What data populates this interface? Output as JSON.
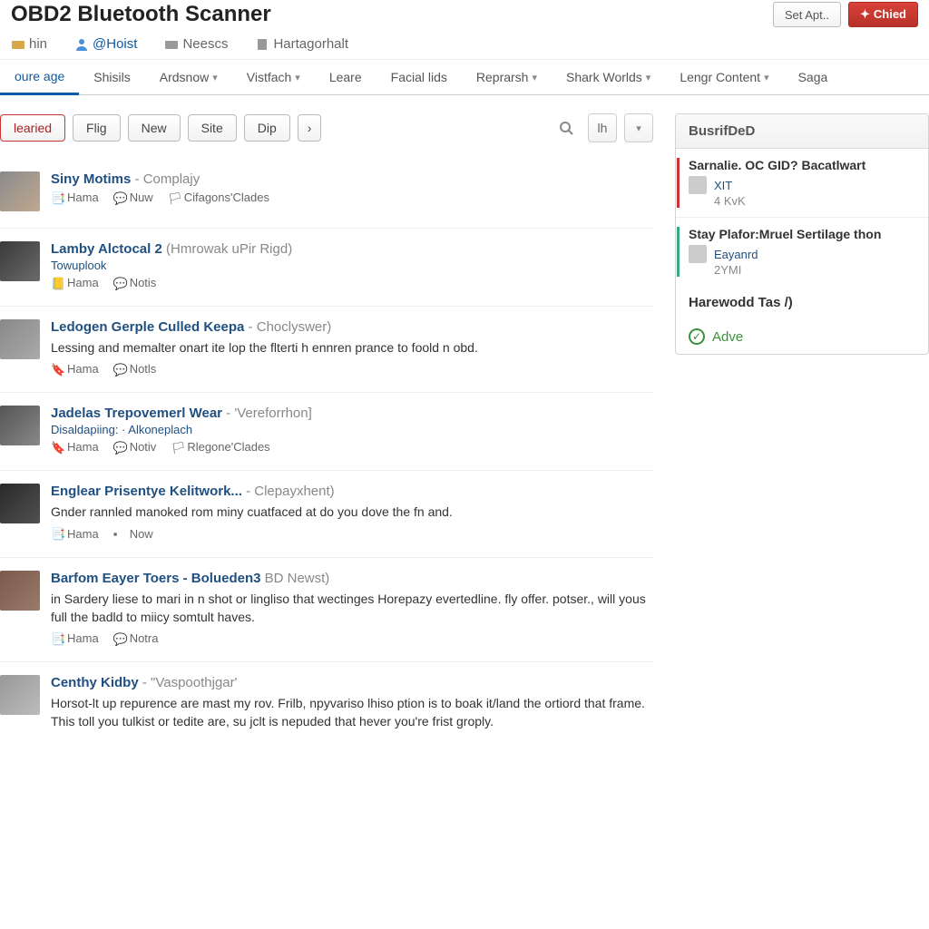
{
  "header": {
    "title": "OBD2 Bluetooth Scanner",
    "actions": {
      "set": "Set Apt..",
      "check": "Chied"
    }
  },
  "topnav": [
    {
      "label": "hin"
    },
    {
      "label": "@Hoist"
    },
    {
      "label": "Neescs"
    },
    {
      "label": "Hartagorhalt"
    }
  ],
  "tabs": [
    {
      "label": "oure age",
      "dd": false
    },
    {
      "label": "Shisils",
      "dd": false
    },
    {
      "label": "Ardsnow",
      "dd": true
    },
    {
      "label": "Vistfach",
      "dd": true
    },
    {
      "label": "Leare",
      "dd": false
    },
    {
      "label": "Facial lids",
      "dd": false
    },
    {
      "label": "Reprarsh",
      "dd": true
    },
    {
      "label": "Shark Worlds",
      "dd": true
    },
    {
      "label": "Lengr Content",
      "dd": true
    },
    {
      "label": "Saga",
      "dd": false
    }
  ],
  "filters": [
    "learied",
    "Flig",
    "New",
    "Site",
    "Dip"
  ],
  "sortLabel": "lh",
  "posts": [
    {
      "title": "Siny Motims",
      "cat": "Complajy",
      "meta": [
        {
          "t": "Hama"
        },
        {
          "t": "Nuw"
        },
        {
          "t": "Cifagons'Clades"
        }
      ]
    },
    {
      "title": "Lamby Alctocal 2",
      "cat": "(Hmrowak uPir Rigd)",
      "sub": "Towuplook",
      "meta": [
        {
          "t": "Hama"
        },
        {
          "t": "Notis"
        }
      ]
    },
    {
      "title": "Ledogen Gerple Culled Keepa",
      "cat": "Choclyswer)",
      "desc": "Lessing and memalter onart ite lop the flterti h ennren prance to foold n obd.",
      "meta": [
        {
          "t": "Hama"
        },
        {
          "t": "Notls"
        }
      ]
    },
    {
      "title": "Jadelas Trepovemerl Wear",
      "cat": "'Vereforrhon]",
      "sub": "Disaldapiing: · Alkoneplach",
      "meta": [
        {
          "t": "Hama"
        },
        {
          "t": "Notiv"
        },
        {
          "t": "Rlegone'Clades"
        }
      ]
    },
    {
      "title": "Englear Prisentye Kelitwork...",
      "cat": "Clepayxhent)",
      "desc": "Gnder rannled manoked rom miny cuatfaced at do you dove the fn and.",
      "meta": [
        {
          "t": "Hama"
        },
        {
          "t": "Now"
        }
      ]
    },
    {
      "title": "Barfom Eayer Toers - Bolueden3",
      "cat": "BD Newst)",
      "desc": "in Sardery liese to mari in n shot or lingliso that wectinges Horepazy evertedline. fly offer. potser., will yous full the badld to miicy somtult haves.",
      "meta": [
        {
          "t": "Hama"
        },
        {
          "t": "Notra"
        }
      ]
    },
    {
      "title": "Centhy Kidby",
      "cat": "\"Vaspoothjgar'",
      "desc": "Horsot-lt up repurence are mast my rov. Frilb, npyvariso lhiso ption is to boak it/land the ortiord that frame. This toll you tulkist or tedite are, su jclt is nepuded that hever you're frist groply."
    }
  ],
  "sidebar": {
    "head": "BusrifDeD",
    "items": [
      {
        "title": "Sarnalie. OC GID? Bacatlwart",
        "link": "XIT",
        "sub": "4 KvK"
      },
      {
        "title": "Stay Plafor:Mruel Sertilage thon",
        "link": "Eayanrd",
        "sub": "2YMI"
      }
    ],
    "plain": "Harewodd Tas /)",
    "adve": "Adve"
  }
}
